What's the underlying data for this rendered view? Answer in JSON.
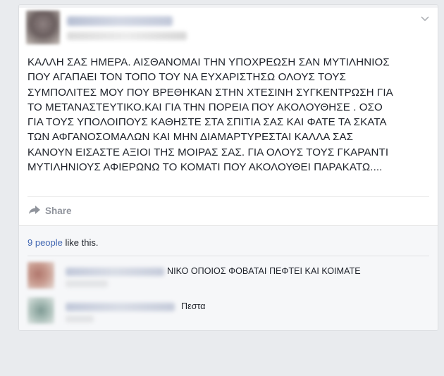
{
  "post": {
    "menu_icon": "chevron-down-icon",
    "text": "ΚΑΛΛΗ ΣΑΣ ΗΜΕΡΑ. ΑΙΣΘΑΝΟΜΑΙ ΤΗΝ ΥΠΟΧΡΕΩΣΗ ΣΑΝ ΜΥΤΙΛΗΝΙΟΣ\nΠΟΥ ΑΓΑΠΑΕΙ ΤΟΝ ΤΟΠΟ ΤΟΥ ΝΑ ΕΥΧΑΡΙΣΤΗΣΩ ΟΛΟΥΣ ΤΟΥΣ\nΣΥΜΠΟΛΙΤΕΣ ΜΟΥ ΠΟΥ ΒΡΕΘΗΚΑΝ ΣΤΗΝ ΧΤΕΣΙΝΗ ΣΥΓΚΕΝΤΡΩΣΗ ΓΙΑ\nΤΟ ΜΕΤΑΝΑΣΤΕΥΤΙΚΟ.ΚΑΙ ΓΙΑ ΤΗΝ ΠΟΡΕΙΑ ΠΟΥ ΑΚΟΛΟΥΘΗΣΕ . ΟΣΟ\nΓΙΑ ΤΟΥΣ ΥΠΟΛΟΙΠΟΥΣ ΚΑΘΗΣΤΕ ΣΤΑ ΣΠΙΤΙΑ ΣΑΣ ΚΑΙ ΦΑΤΕ ΤΑ ΣΚΑΤΑ\nΤΩΝ ΑΦΓΑΝΟΣΟΜΑΛΩΝ ΚΑΙ ΜΗΝ ΔΙΑΜΑΡΤΥΡΕΣΤΑΙ ΚΑΛΛΑ ΣΑΣ\nΚΑΝΟΥΝ ΕΙΣΑΣΤΕ ΑΞΙΟΙ ΤΗΣ ΜΟΙΡΑΣ ΣΑΣ. ΓΙΑ ΟΛΟΥΣ ΤΟΥΣ ΓΚΑΡΑΝΤΙ\nΜΥΤΙΛΗΝΙΟΥΣ ΑΦΙΕΡΩΝΩ ΤΟ ΚΟΜΑΤΙ ΠΟΥ ΑΚΟΛΟΥΘΕΙ ΠΑΡΑΚΑΤΩ....",
    "share_label": "Share",
    "share_icon": "share-arrow-icon"
  },
  "likes": {
    "count_link": "9 people",
    "suffix": " like this."
  },
  "comments": [
    {
      "text": "ΝΙΚΟ ΟΠΟΙΟΣ ΦΟΒΑΤΑΙ ΠΕΦΤΕΙ ΚΑΙ ΚΟΙΜΑΤΕ"
    },
    {
      "text": "Πεστα"
    }
  ],
  "colors": {
    "background": "#e9ebee",
    "card": "#ffffff",
    "link": "#4267b2",
    "muted": "#90949c",
    "comment_area": "#f6f7f9"
  }
}
